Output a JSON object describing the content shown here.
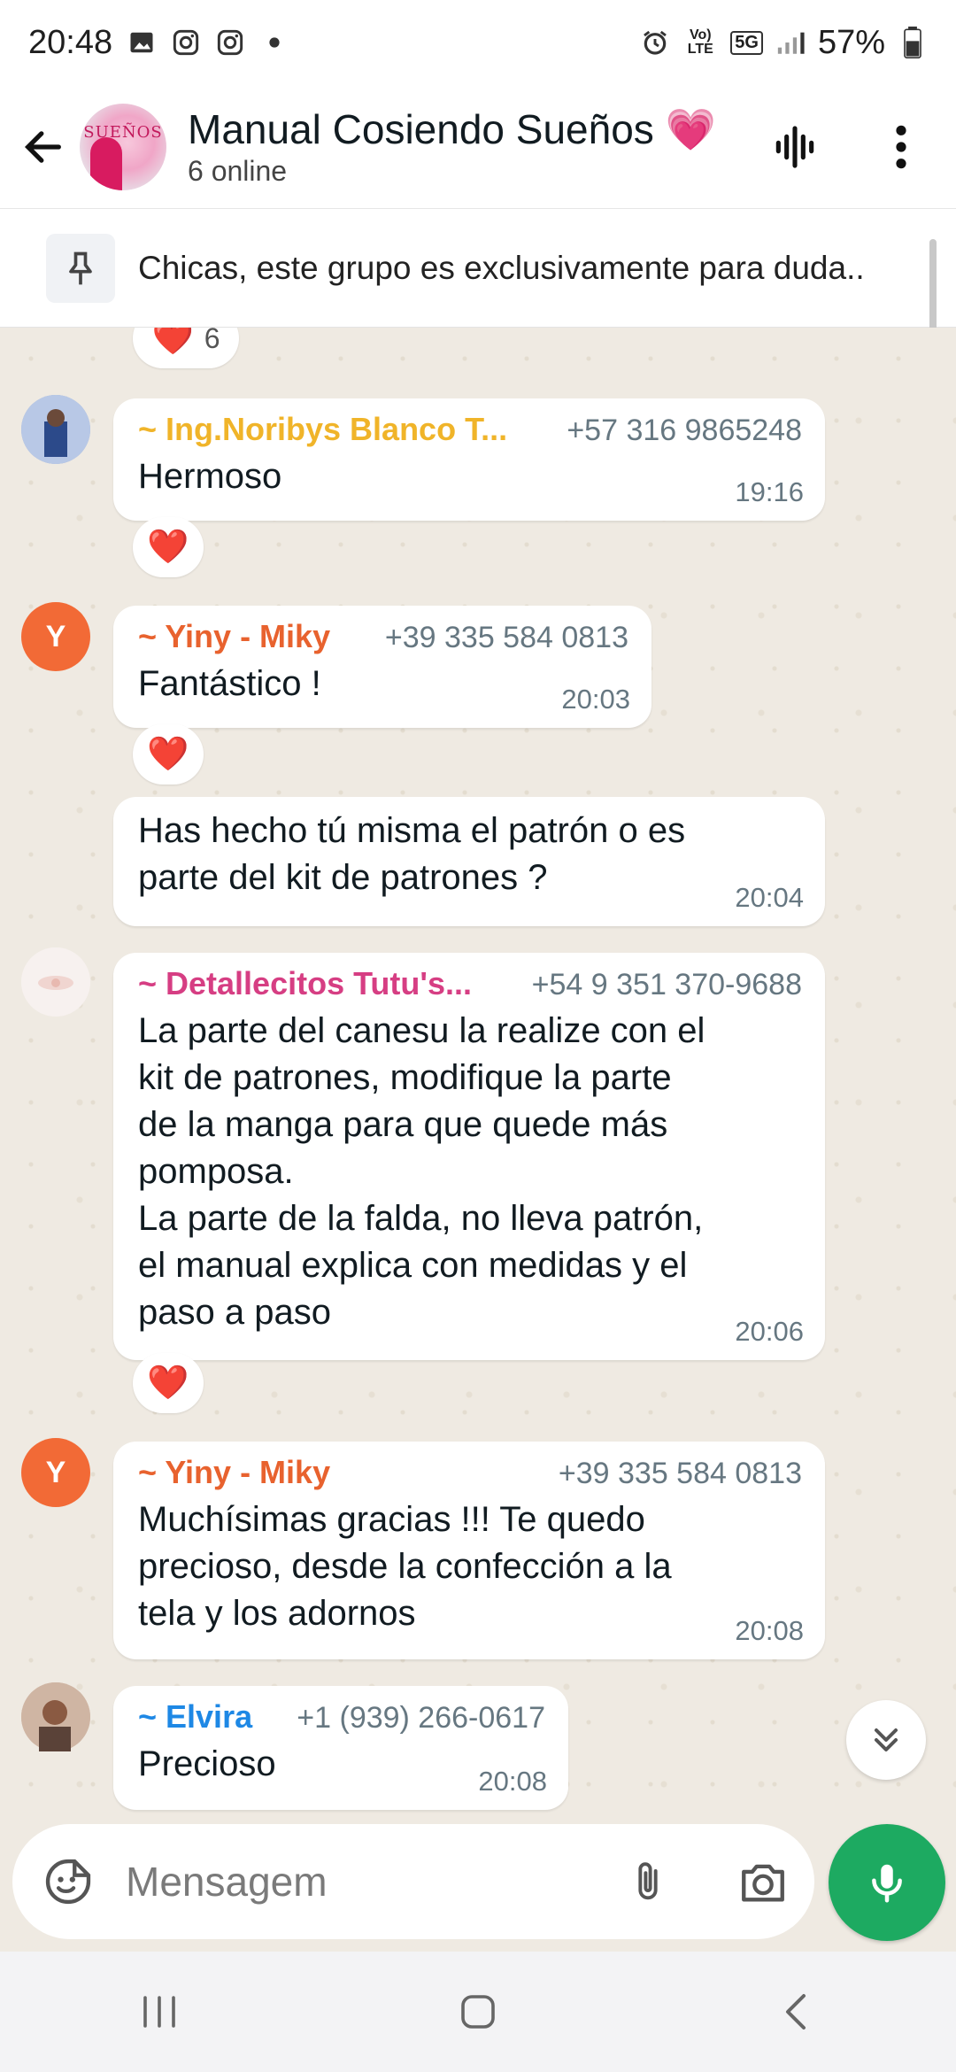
{
  "status_bar": {
    "time": "20:48",
    "battery": "57%",
    "network": "5G",
    "volte": "Vo) LTE"
  },
  "header": {
    "title": "Manual Cosiendo Sueños 💗",
    "subtitle": "6 online",
    "avatar_text": "SUEÑOS"
  },
  "pinned": {
    "text": "Chicas, este grupo es exclusivamente para duda.."
  },
  "colors": {
    "accent": "#1daa61",
    "sender_yellow": "#f0b429",
    "sender_orange": "#e8622e",
    "sender_pink": "#d63e83",
    "sender_blue": "#1e88e5"
  },
  "messages": [
    {
      "id": "m0",
      "reaction": "❤️",
      "reaction_count": "6"
    },
    {
      "id": "m1",
      "sender": "~ Ing.Noribys Blanco T...",
      "phone": "+57 316 9865248",
      "text": "Hermoso",
      "time": "19:16",
      "reaction": "❤️"
    },
    {
      "id": "m2",
      "sender": "~ Yiny - Miky",
      "phone": "+39 335 584 0813",
      "text": "Fantástico !",
      "time": "20:03",
      "reaction": "❤️",
      "avatar_letter": "Y"
    },
    {
      "id": "m3",
      "text_lines": [
        "Has hecho tú misma el patrón o es",
        "parte del kit de patrones ?"
      ],
      "time": "20:04"
    },
    {
      "id": "m4",
      "sender": "~ Detallecitos Tutu's...",
      "phone": "+54 9 351 370-9688",
      "text_lines": [
        "La parte del canesu la realize con el",
        "kit de patrones, modifique la parte",
        "de la manga para que quede más",
        "pomposa.",
        "La parte de la falda, no lleva patrón,",
        "el manual explica con medidas y el",
        "paso a paso"
      ],
      "time": "20:06",
      "reaction": "❤️"
    },
    {
      "id": "m5",
      "sender": "~ Yiny - Miky",
      "phone": "+39 335 584 0813",
      "text_lines": [
        "Muchísimas gracias !!! Te quedo",
        "precioso, desde la confección a la",
        "tela y los adornos"
      ],
      "time": "20:08",
      "avatar_letter": "Y"
    },
    {
      "id": "m6",
      "sender": "~ Elvira",
      "phone": "+1 (939) 266-0617",
      "text": "Precioso",
      "time": "20:08"
    }
  ],
  "composer": {
    "placeholder": "Mensagem"
  }
}
